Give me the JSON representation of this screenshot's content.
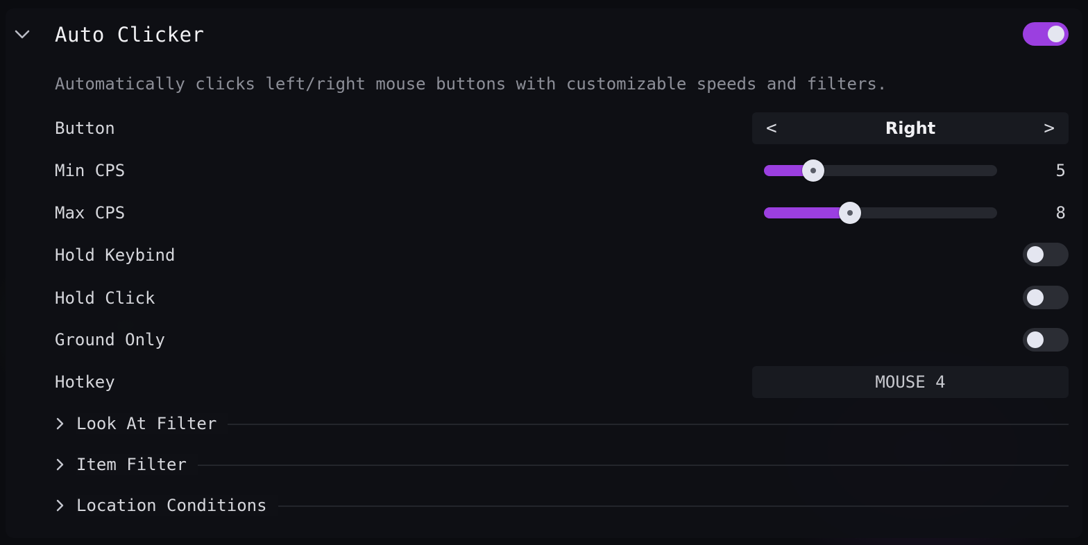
{
  "module": {
    "title": "Auto Clicker",
    "enabled": true,
    "description": "Automatically clicks left/right mouse buttons with customizable speeds and filters."
  },
  "settings": {
    "button": {
      "label": "Button",
      "value": "Right",
      "prev_glyph": "<",
      "next_glyph": ">"
    },
    "min_cps": {
      "label": "Min CPS",
      "value": "5",
      "fraction": 0.21
    },
    "max_cps": {
      "label": "Max CPS",
      "value": "8",
      "fraction": 0.37
    },
    "hold_keybind": {
      "label": "Hold Keybind",
      "enabled": false
    },
    "hold_click": {
      "label": "Hold Click",
      "enabled": false
    },
    "ground_only": {
      "label": "Ground Only",
      "enabled": false
    },
    "hotkey": {
      "label": "Hotkey",
      "value": "MOUSE 4"
    }
  },
  "sections": [
    {
      "label": "Look At Filter"
    },
    {
      "label": "Item Filter"
    },
    {
      "label": "Location Conditions"
    }
  ],
  "colors": {
    "accent": "#9b3fe0",
    "toggle_off": "#2b2d34",
    "panel_bg": "#0f1015"
  },
  "icons": {
    "collapse": "chevron-down-icon",
    "expand": "chevron-right-icon"
  }
}
